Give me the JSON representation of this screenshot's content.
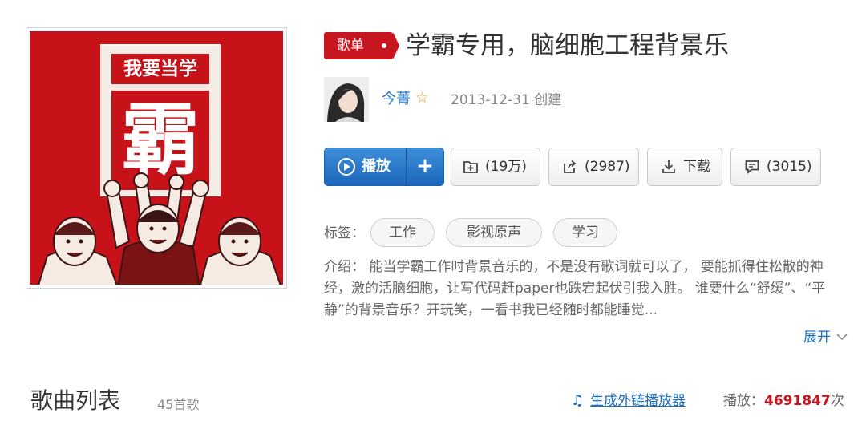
{
  "cover": {
    "poster_top": "我要当学",
    "poster_big": "霸"
  },
  "header": {
    "badge": "歌单",
    "title": "学霸专用，脑细胞工程背景乐"
  },
  "creator": {
    "name": "今菁",
    "created": "2013-12-31 创建"
  },
  "actions": {
    "play_label": "播放",
    "add_label": "+",
    "collect_label": "(19万)",
    "share_label": "(2987)",
    "download_label": "下载",
    "comment_label": "(3015)"
  },
  "tags": {
    "label": "标签：",
    "items": [
      "工作",
      "影视原声",
      "学习"
    ]
  },
  "description": {
    "text": "介绍： 能当学霸工作时背景音乐的，不是没有歌词就可以了， 要能抓得住松散的神经，激的活脑细胞，让写代码赶paper也跌宕起伏引我入胜。 谁要什么“舒缓”、“平静”的背景音乐？开玩笑，一看书我已经随时都能睡觉...",
    "expand_label": "展开"
  },
  "song_list": {
    "title": "歌曲列表",
    "count": "45首歌",
    "external_player_link": "生成外链播放器",
    "plays_label": "播放：",
    "plays_count": "4691847",
    "plays_unit": "次"
  },
  "colors": {
    "accent_red": "#c81620",
    "link_blue": "#1a6fc4",
    "play_button_blue": "#2b79cc"
  },
  "icons": {
    "play": "play-circle-icon",
    "collect": "folder-add-icon",
    "share": "share-icon",
    "download": "download-icon",
    "comment": "comment-icon",
    "star": "star-icon",
    "music_note": "music-note-icon",
    "expand": "chevron-down-icon"
  }
}
